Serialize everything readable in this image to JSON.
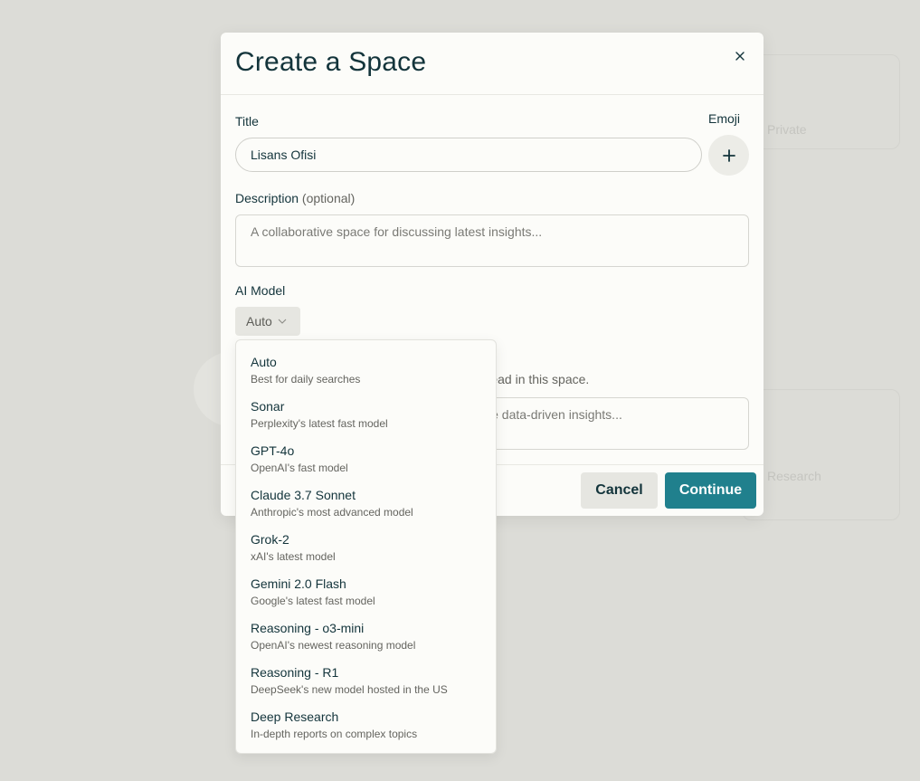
{
  "background": {
    "texts": [
      "Private",
      "Research"
    ]
  },
  "modal": {
    "title": "Create a Space",
    "title_label": "Title",
    "emoji_label": "Emoji",
    "title_value": "Lisans Ofisi",
    "description_label": "Description",
    "description_optional": "(optional)",
    "description_placeholder": "A collaborative space for discussing latest insights...",
    "ai_model_label": "AI Model",
    "ai_model_selected": "Auto",
    "instructions_visible_text": "thread in this space.",
    "instructions_placeholder_visible": "itize data-driven insights...",
    "cancel_label": "Cancel",
    "continue_label": "Continue"
  },
  "dropdown": {
    "items": [
      {
        "name": "Auto",
        "desc": "Best for daily searches"
      },
      {
        "name": "Sonar",
        "desc": "Perplexity's latest fast model"
      },
      {
        "name": "GPT-4o",
        "desc": "OpenAI's fast model"
      },
      {
        "name": "Claude 3.7 Sonnet",
        "desc": "Anthropic's most advanced model"
      },
      {
        "name": "Grok-2",
        "desc": "xAI's latest model"
      },
      {
        "name": "Gemini 2.0 Flash",
        "desc": "Google's latest fast model"
      },
      {
        "name": "Reasoning - o3-mini",
        "desc": "OpenAI's newest reasoning model"
      },
      {
        "name": "Reasoning - R1",
        "desc": "DeepSeek's new model hosted in the US"
      },
      {
        "name": "Deep Research",
        "desc": "In-depth reports on complex topics"
      }
    ]
  },
  "colors": {
    "accent": "#20808d",
    "text": "#13343b",
    "muted": "#64645f",
    "backdrop": "#dcdcd7"
  }
}
